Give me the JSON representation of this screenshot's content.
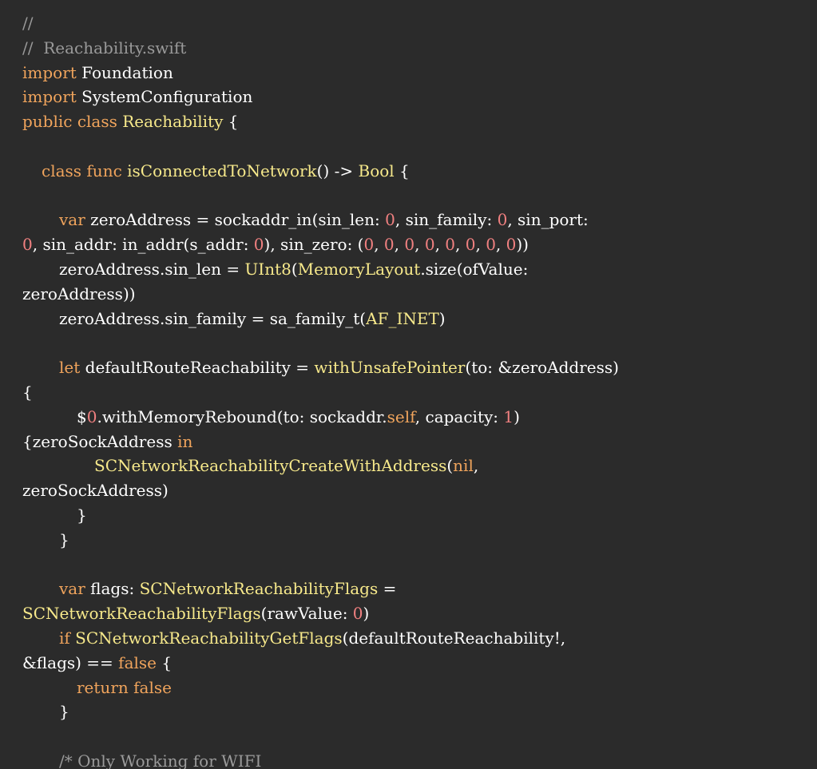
{
  "colors": {
    "background": "#2b2b2b",
    "plain": "#ffffff",
    "comment": "#9a9a9a",
    "keyword": "#f0a45c",
    "type": "#f7e98b",
    "number": "#f08080"
  },
  "code": {
    "lines": [
      {
        "indent": 0,
        "tokens": [
          {
            "k": "comment",
            "t": "//"
          }
        ]
      },
      {
        "indent": 0,
        "tokens": [
          {
            "k": "comment",
            "t": "//  Reachability.swift"
          }
        ]
      },
      {
        "indent": 0,
        "tokens": [
          {
            "k": "keyword",
            "t": "import"
          },
          {
            "k": "plain",
            "t": " Foundation"
          }
        ]
      },
      {
        "indent": 0,
        "tokens": [
          {
            "k": "keyword",
            "t": "import"
          },
          {
            "k": "plain",
            "t": " SystemConfiguration"
          }
        ]
      },
      {
        "indent": 0,
        "tokens": [
          {
            "k": "keyword",
            "t": "public class"
          },
          {
            "k": "plain",
            "t": " "
          },
          {
            "k": "type",
            "t": "Reachability"
          },
          {
            "k": "plain",
            "t": " {"
          }
        ]
      },
      {
        "indent": 0,
        "tokens": []
      },
      {
        "indent": 1,
        "tokens": [
          {
            "k": "keyword",
            "t": "class func"
          },
          {
            "k": "plain",
            "t": " "
          },
          {
            "k": "type",
            "t": "isConnectedToNetwork"
          },
          {
            "k": "plain",
            "t": "() -> "
          },
          {
            "k": "type",
            "t": "Bool"
          },
          {
            "k": "plain",
            "t": " {"
          }
        ]
      },
      {
        "indent": 0,
        "tokens": []
      },
      {
        "indent": 2,
        "tokens": [
          {
            "k": "keyword",
            "t": "var"
          },
          {
            "k": "plain",
            "t": " zeroAddress = sockaddr_in(sin_len: "
          },
          {
            "k": "number",
            "t": "0"
          },
          {
            "k": "plain",
            "t": ", sin_family: "
          },
          {
            "k": "number",
            "t": "0"
          },
          {
            "k": "plain",
            "t": ", sin_port:"
          }
        ]
      },
      {
        "indent": 0,
        "tokens": [
          {
            "k": "number",
            "t": "0"
          },
          {
            "k": "plain",
            "t": ", sin_addr: in_addr(s_addr: "
          },
          {
            "k": "number",
            "t": "0"
          },
          {
            "k": "plain",
            "t": "), sin_zero: ("
          },
          {
            "k": "number",
            "t": "0"
          },
          {
            "k": "plain",
            "t": ", "
          },
          {
            "k": "number",
            "t": "0"
          },
          {
            "k": "plain",
            "t": ", "
          },
          {
            "k": "number",
            "t": "0"
          },
          {
            "k": "plain",
            "t": ", "
          },
          {
            "k": "number",
            "t": "0"
          },
          {
            "k": "plain",
            "t": ", "
          },
          {
            "k": "number",
            "t": "0"
          },
          {
            "k": "plain",
            "t": ", "
          },
          {
            "k": "number",
            "t": "0"
          },
          {
            "k": "plain",
            "t": ", "
          },
          {
            "k": "number",
            "t": "0"
          },
          {
            "k": "plain",
            "t": ", "
          },
          {
            "k": "number",
            "t": "0"
          },
          {
            "k": "plain",
            "t": "))"
          }
        ]
      },
      {
        "indent": 2,
        "tokens": [
          {
            "k": "plain",
            "t": "zeroAddress.sin_len = "
          },
          {
            "k": "type",
            "t": "UInt8"
          },
          {
            "k": "plain",
            "t": "("
          },
          {
            "k": "type",
            "t": "MemoryLayout"
          },
          {
            "k": "plain",
            "t": ".size(ofValue:"
          }
        ]
      },
      {
        "indent": 0,
        "tokens": [
          {
            "k": "plain",
            "t": "zeroAddress))"
          }
        ]
      },
      {
        "indent": 2,
        "tokens": [
          {
            "k": "plain",
            "t": "zeroAddress.sin_family = sa_family_t("
          },
          {
            "k": "type",
            "t": "AF_INET"
          },
          {
            "k": "plain",
            "t": ")"
          }
        ]
      },
      {
        "indent": 0,
        "tokens": []
      },
      {
        "indent": 2,
        "tokens": [
          {
            "k": "keyword",
            "t": "let"
          },
          {
            "k": "plain",
            "t": " defaultRouteReachability = "
          },
          {
            "k": "type",
            "t": "withUnsafePointer"
          },
          {
            "k": "plain",
            "t": "(to: &zeroAddress)"
          }
        ]
      },
      {
        "indent": 0,
        "tokens": [
          {
            "k": "plain",
            "t": "{"
          }
        ]
      },
      {
        "indent": 3,
        "tokens": [
          {
            "k": "plain",
            "t": "$"
          },
          {
            "k": "number",
            "t": "0"
          },
          {
            "k": "plain",
            "t": ".withMemoryRebound(to: sockaddr."
          },
          {
            "k": "keyword",
            "t": "self"
          },
          {
            "k": "plain",
            "t": ", capacity: "
          },
          {
            "k": "number",
            "t": "1"
          },
          {
            "k": "plain",
            "t": ")"
          }
        ]
      },
      {
        "indent": 0,
        "tokens": [
          {
            "k": "plain",
            "t": "{zeroSockAddress "
          },
          {
            "k": "keyword",
            "t": "in"
          }
        ]
      },
      {
        "indent": 4,
        "tokens": [
          {
            "k": "type",
            "t": "SCNetworkReachabilityCreateWithAddress"
          },
          {
            "k": "plain",
            "t": "("
          },
          {
            "k": "keyword",
            "t": "nil"
          },
          {
            "k": "plain",
            "t": ","
          }
        ]
      },
      {
        "indent": 0,
        "tokens": [
          {
            "k": "plain",
            "t": "zeroSockAddress)"
          }
        ]
      },
      {
        "indent": 3,
        "tokens": [
          {
            "k": "plain",
            "t": "}"
          }
        ]
      },
      {
        "indent": 2,
        "tokens": [
          {
            "k": "plain",
            "t": "}"
          }
        ]
      },
      {
        "indent": 0,
        "tokens": []
      },
      {
        "indent": 2,
        "tokens": [
          {
            "k": "keyword",
            "t": "var"
          },
          {
            "k": "plain",
            "t": " flags: "
          },
          {
            "k": "type",
            "t": "SCNetworkReachabilityFlags"
          },
          {
            "k": "plain",
            "t": " ="
          }
        ]
      },
      {
        "indent": 0,
        "tokens": [
          {
            "k": "type",
            "t": "SCNetworkReachabilityFlags"
          },
          {
            "k": "plain",
            "t": "(rawValue: "
          },
          {
            "k": "number",
            "t": "0"
          },
          {
            "k": "plain",
            "t": ")"
          }
        ]
      },
      {
        "indent": 2,
        "tokens": [
          {
            "k": "keyword",
            "t": "if"
          },
          {
            "k": "plain",
            "t": " "
          },
          {
            "k": "type",
            "t": "SCNetworkReachabilityGetFlags"
          },
          {
            "k": "plain",
            "t": "(defaultRouteReachability!,"
          }
        ]
      },
      {
        "indent": 0,
        "tokens": [
          {
            "k": "plain",
            "t": "&flags) == "
          },
          {
            "k": "keyword",
            "t": "false"
          },
          {
            "k": "plain",
            "t": " {"
          }
        ]
      },
      {
        "indent": 3,
        "tokens": [
          {
            "k": "keyword",
            "t": "return false"
          }
        ]
      },
      {
        "indent": 2,
        "tokens": [
          {
            "k": "plain",
            "t": "}"
          }
        ]
      },
      {
        "indent": 0,
        "tokens": []
      },
      {
        "indent": 2,
        "tokens": [
          {
            "k": "comment",
            "t": "/* Only Working for WIFI"
          }
        ]
      }
    ]
  }
}
